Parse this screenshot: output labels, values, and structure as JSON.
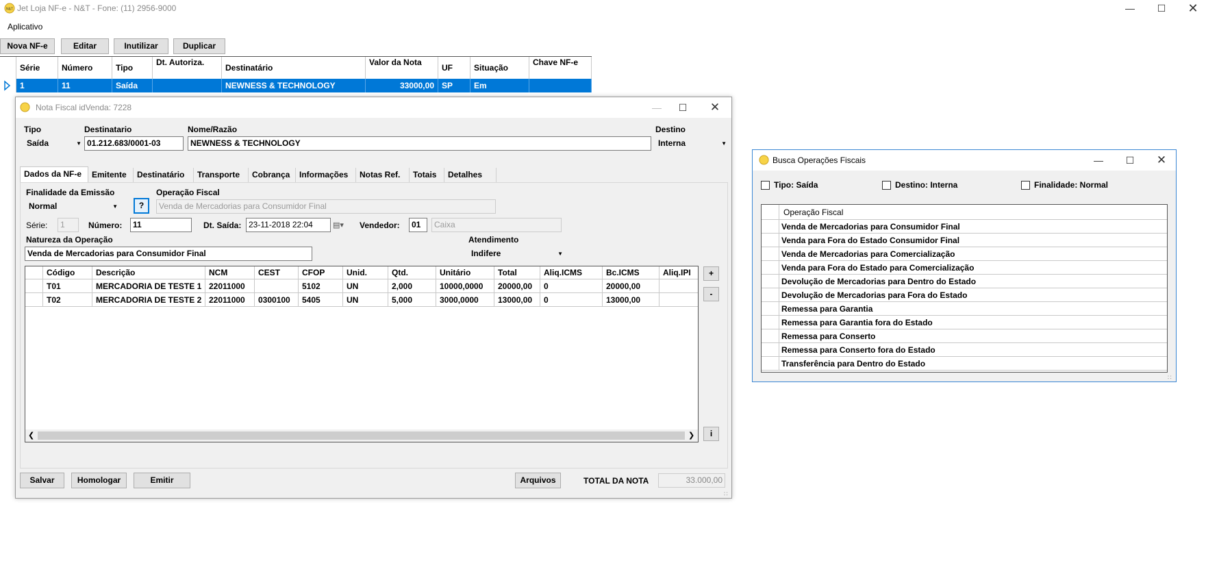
{
  "app": {
    "title": "Jet Loja NF-e - N&T - Fone: (11) 2956-9000",
    "logo_text": "N&T",
    "menu": [
      "Aplicativo"
    ],
    "toolbar": [
      "Nova NF-e",
      "Editar",
      "Inutilizar",
      "Duplicar"
    ]
  },
  "main_grid": {
    "columns": [
      "Série",
      "Número",
      "Tipo",
      "Dt. Autoriza.",
      "Destinatário",
      "Valor da Nota",
      "UF",
      "Situação",
      "Chave NF-e"
    ],
    "rows": [
      {
        "serie": "1",
        "numero": "11",
        "tipo": "Saída",
        "dt": "",
        "dest": "NEWNESS & TECHNOLOGY",
        "valor": "33000,00",
        "uf": "SP",
        "situacao": "Em Digitação",
        "chave": ""
      }
    ]
  },
  "nf_window": {
    "title": "Nota Fiscal idVenda: 7228",
    "tipo_label": "Tipo",
    "tipo_value": "Saída",
    "destinatario_label": "Destinatario",
    "destinatario_value": "01.212.683/0001-03",
    "nome_label": "Nome/Razão",
    "nome_value": "NEWNESS & TECHNOLOGY",
    "destino_label": "Destino",
    "destino_value": "Interna",
    "tabs": [
      "Dados da NF-e",
      "Emitente",
      "Destinatário",
      "Transporte",
      "Cobrança",
      "Informações",
      "Notas Ref.",
      "Totais",
      "Detalhes"
    ],
    "finalidade_label": "Finalidade da Emissão",
    "finalidade_value": "Normal",
    "help_button": "?",
    "operacao_label": "Operação Fiscal",
    "operacao_value": "Venda de Mercadorias para Consumidor Final",
    "serie_label": "Série:",
    "serie_value": "1",
    "numero_label": "Número:",
    "numero_value": "11",
    "dtsaida_label": "Dt. Saída:",
    "dtsaida_value": "23-11-2018 22:04",
    "vendedor_label": "Vendedor:",
    "vendedor_code": "01",
    "vendedor_name": "Caixa",
    "natureza_label": "Natureza da Operação",
    "natureza_value": "Venda de Mercadorias para Consumidor Final",
    "atendimento_label": "Atendimento",
    "atendimento_value": "Indifere",
    "items_columns": [
      "Código",
      "Descrição",
      "NCM",
      "CEST",
      "CFOP",
      "Unid.",
      "Qtd.",
      "Unitário",
      "Total",
      "Aliq.ICMS",
      "Bc.ICMS",
      "Aliq.IPI"
    ],
    "items": [
      {
        "codigo": "T01",
        "descricao": "MERCADORIA DE TESTE 1",
        "ncm": "22011000",
        "cest": "",
        "cfop": "5102",
        "unid": "UN",
        "qtd": "2,000",
        "unitario": "10000,0000",
        "total": "20000,00",
        "aliq_icms": "0",
        "bc_icms": "20000,00",
        "aliq_ipi": ""
      },
      {
        "codigo": "T02",
        "descricao": "MERCADORIA DE TESTE 2",
        "ncm": "22011000",
        "cest": "0300100",
        "cfop": "5405",
        "unid": "UN",
        "qtd": "5,000",
        "unitario": "3000,0000",
        "total": "13000,00",
        "aliq_icms": "0",
        "bc_icms": "13000,00",
        "aliq_ipi": ""
      }
    ],
    "side_buttons": [
      "+",
      "-",
      "i"
    ],
    "footer": {
      "salvar": "Salvar",
      "homologar": "Homologar",
      "emitir": "Emitir",
      "arquivos": "Arquivos",
      "total_label": "TOTAL DA NOTA",
      "total_value": "33.000,00"
    }
  },
  "busca_window": {
    "title": "Busca Operações Fiscais",
    "filters": [
      "Tipo: Saída",
      "Destino: Interna",
      "Finalidade: Normal"
    ],
    "column": "Operação Fiscal",
    "operations": [
      "Venda de Mercadorias para Consumidor Final",
      "Venda para Fora do Estado Consumidor Final",
      "Venda de Mercadorias para Comercialização",
      "Venda para Fora do Estado para Comercialização",
      "Devolução de Mercadorias para Dentro do Estado",
      "Devolução de Mercadorias para Fora do Estado",
      "Remessa para Garantia",
      "Remessa para Garantia fora do Estado",
      "Remessa para Conserto",
      "Remessa para Conserto fora do Estado",
      "Transferência para Dentro do Estado"
    ]
  }
}
